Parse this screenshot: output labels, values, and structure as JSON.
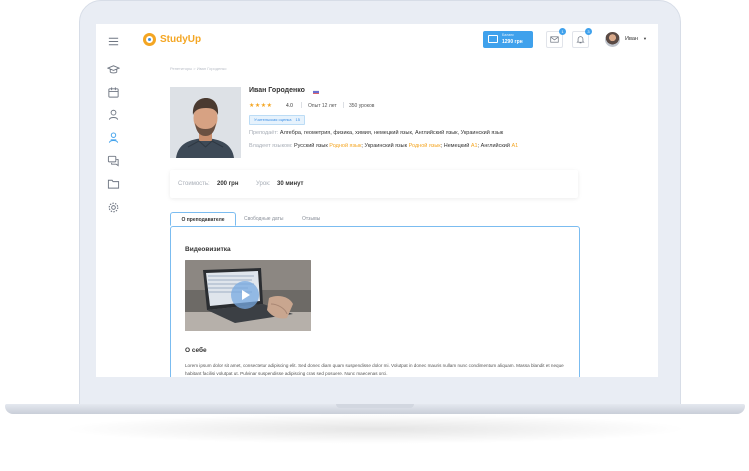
{
  "colors": {
    "accent": "#3fa1ec",
    "brand": "#f4a623",
    "frame": "#e9edf4"
  },
  "app": {
    "logo": "StudyUp"
  },
  "sidebar": {
    "items": [
      {
        "icon": "menu-icon"
      },
      {
        "icon": "graduation-cap-icon"
      },
      {
        "icon": "calendar-icon"
      },
      {
        "icon": "user-icon"
      },
      {
        "icon": "teacher-icon"
      },
      {
        "icon": "chat-icon"
      },
      {
        "icon": "folder-icon"
      },
      {
        "icon": "gear-icon"
      }
    ]
  },
  "header": {
    "balance_label": "Баланс",
    "balance_value": "1290 грн",
    "messages_badge": "1",
    "notifications_badge": "3",
    "user_name": "Иван"
  },
  "breadcrumb": "Репетиторы > Иван Городенко",
  "teacher": {
    "name": "Иван Городенко",
    "stars": "★★★★",
    "rating": "4.0",
    "experience": "Опыт 12 лет",
    "lessons": "350 уроков",
    "tag_label": "Учительская оценка",
    "tag_value": "15",
    "subjects_label": "Преподаёт:",
    "subjects": "Алгебра, геометрия, физика, химия, немецкий язык, Английский язык, Украинский язык",
    "languages_label": "Владеет языком:",
    "lang1": "Русский язык",
    "lang1_level": "Родной язык",
    "lang2": "; Украинский язык",
    "lang2_level": "Родной язык",
    "lang3": "; Немецкий",
    "lang3_level": "A1",
    "lang4": "; Английский",
    "lang4_level": "A1"
  },
  "price": {
    "cost_label": "Стоимость:",
    "cost_value": "200 грн",
    "lesson_label": "Урок:",
    "lesson_value": "30 минут"
  },
  "tabs": [
    {
      "label": "О преподавателе"
    },
    {
      "label": "Свободные даты"
    },
    {
      "label": "Отзывы"
    }
  ],
  "content": {
    "video_title": "Видеовизитка",
    "about_title": "О себе",
    "about_text": "Lorem ipsum dolor sit amet, consectetur adipiscing elit. Sed donec diam quam suspendisse dolor mi. Volutpat in donec mauris nullam nunc condimentum aliquam. Massa blandit et neque habitant facilisi volutpat ut. Pulvinar suspendisse adipiscing cras sed posuere. Nunc maecenas orci."
  }
}
